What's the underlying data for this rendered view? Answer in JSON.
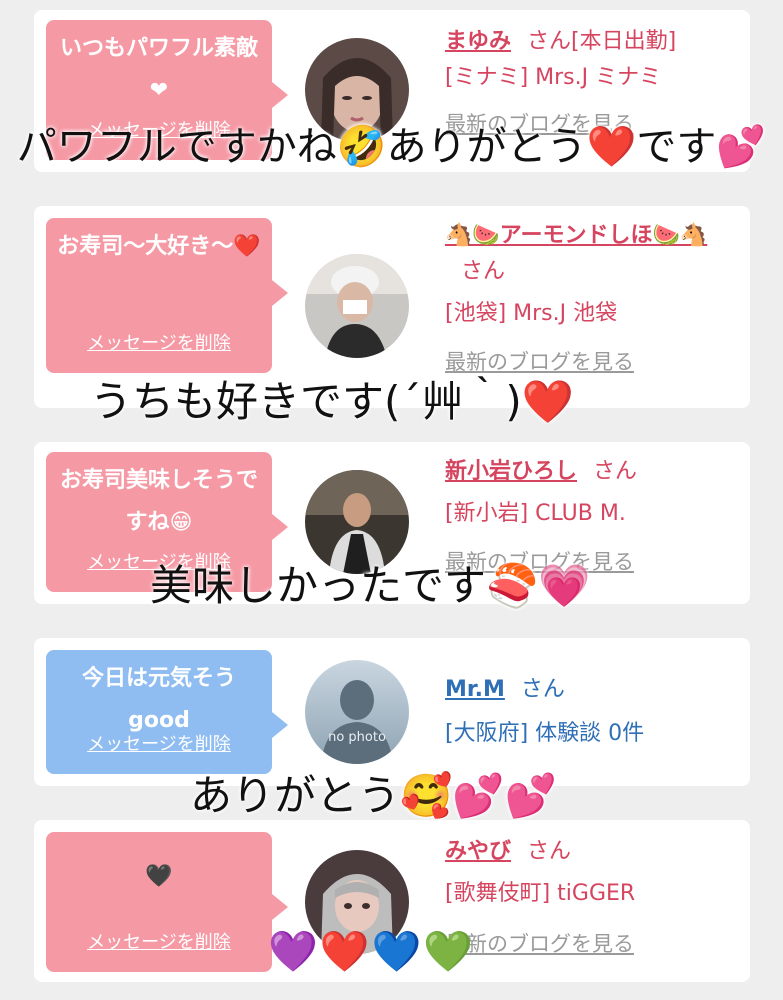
{
  "delete_label": "メッセージを削除",
  "blog_label": "最新のブログを見る",
  "colors": {
    "pink_bubble": "#f59aa5",
    "blue_bubble": "#8fbdf1",
    "pink_text": "#d6455f",
    "blue_text": "#2f6fb6"
  },
  "cards": [
    {
      "message": "いつもパワフル素敵❤",
      "name": "まゆみ",
      "san": "さん[本日出勤]",
      "shop": "[ミナミ] Mrs.J ミナミ",
      "color": "pink"
    },
    {
      "message": "お寿司〜大好き〜❤️",
      "name": "🐴🍉アーモンドしほ🍉🐴",
      "san": "さん",
      "shop": "[池袋] Mrs.J 池袋",
      "color": "pink"
    },
    {
      "message": "お寿司美味しそうですね😁",
      "name": "新小岩ひろし",
      "san": "さん",
      "shop": "[新小岩] CLUB M.",
      "color": "pink"
    },
    {
      "message": "今日は元気そうgood",
      "name": "Mr.M",
      "san": "さん",
      "shop": "[大阪府] 体験談 0件",
      "color": "blue",
      "avatar_text": "no photo"
    },
    {
      "message": "🖤",
      "name": "みやび",
      "san": "さん",
      "shop": "[歌舞伎町] tiGGER",
      "color": "pink"
    }
  ],
  "overlays": {
    "one": "パワフルですかね🤣ありがとう❤️です💕",
    "two": "うちも好きです(´艸｀)❤️",
    "three": "美味しかったです🍣💗",
    "four": "ありがとう🥰💕💕",
    "five": "💜❤️💙💚"
  }
}
